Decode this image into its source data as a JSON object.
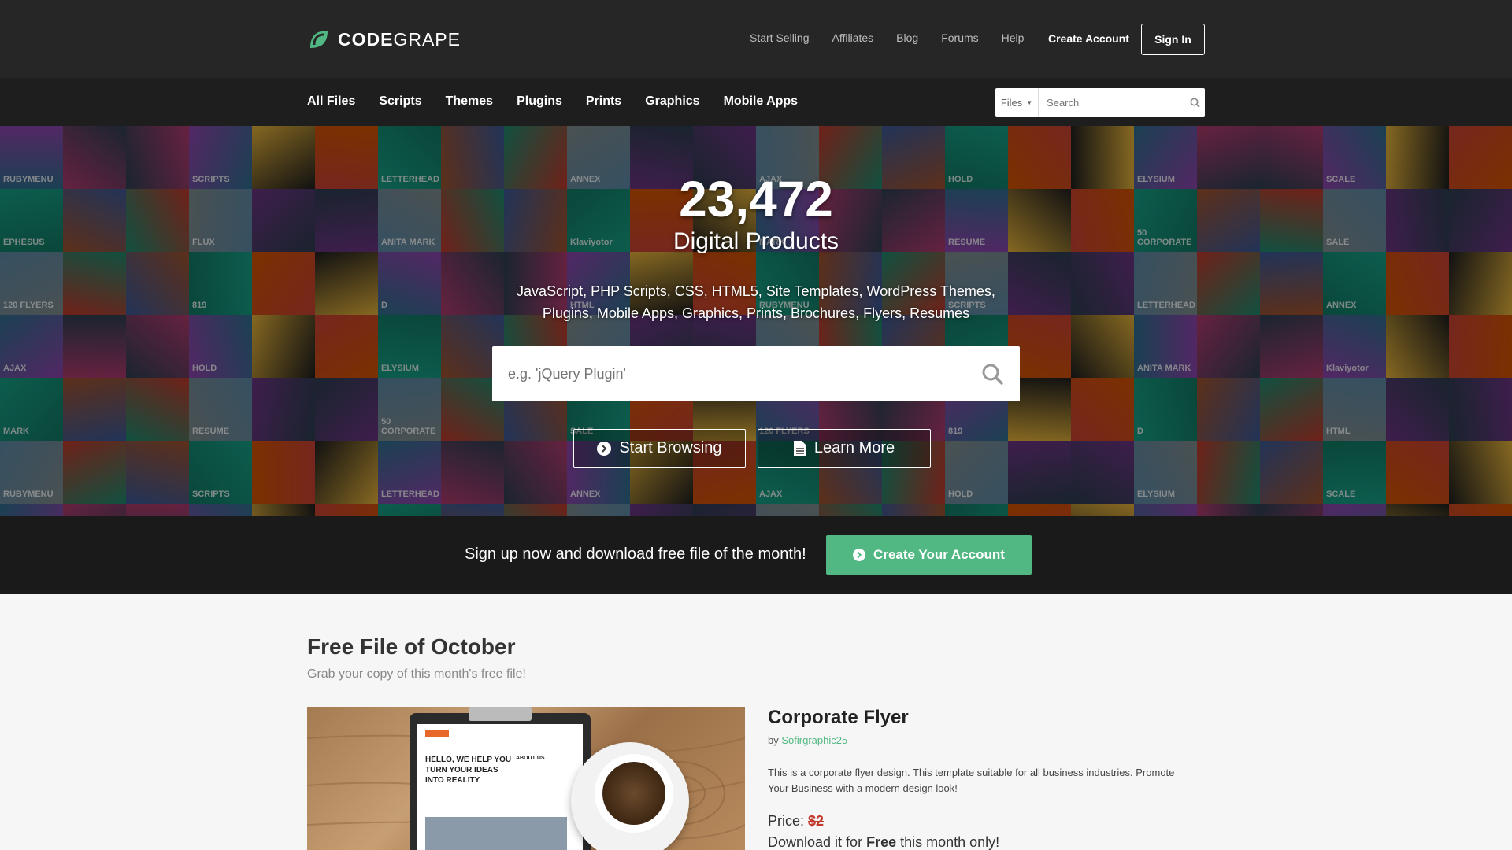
{
  "brand": {
    "name_bold": "CODE",
    "name_light": "GRAPE",
    "color": "#52b883"
  },
  "header": {
    "links": [
      "Start Selling",
      "Affiliates",
      "Blog",
      "Forums",
      "Help"
    ],
    "create_account": "Create Account",
    "sign_in": "Sign In"
  },
  "nav": {
    "categories": [
      "All Files",
      "Scripts",
      "Themes",
      "Plugins",
      "Prints",
      "Graphics",
      "Mobile Apps"
    ],
    "search_scope": "Files",
    "search_placeholder": "Search"
  },
  "hero": {
    "count": "23,472",
    "subtitle": "Digital Products",
    "description": "JavaScript, PHP Scripts, CSS, HTML5, Site Templates, WordPress Themes, Plugins, Mobile Apps, Graphics, Prints, Brochures, Flyers, Resumes",
    "search_placeholder": "e.g. 'jQuery Plugin'",
    "start_browsing": "Start Browsing",
    "learn_more": "Learn More",
    "tiles": [
      "RUBYMENU",
      "SCRIPTS",
      "LETTERHEAD",
      "ANNEX",
      "AJAX",
      "HOLD",
      "ELYSIUM",
      "SCALE",
      "EPHESUS",
      "FLUX",
      "ANITA MARK",
      "Klaviyotor",
      "MARK",
      "RESUME",
      "50 CORPORATE",
      "SALE",
      "120 FLYERS",
      "819",
      "D",
      "HTML"
    ]
  },
  "signup_band": {
    "text": "Sign up now and download free file of the month!",
    "button": "Create Your Account"
  },
  "free_file": {
    "title": "Free File of October",
    "subtitle": "Grab your copy of this month's free file!",
    "product_name": "Corporate Flyer",
    "by_label": "by",
    "author": "Sofirgraphic25",
    "description": "This is a corporate flyer design. This template suitable for all business industries. Promote Your Business with a modern design look!",
    "price_label": "Price:",
    "old_price": "$2",
    "download_prefix": "Download it for",
    "download_free": "Free",
    "download_suffix": "this month only!",
    "image_text": [
      "HELLO, WE HELP YOU",
      "TURN YOUR IDEAS",
      "INTO REALITY",
      "ABOUT US"
    ]
  }
}
